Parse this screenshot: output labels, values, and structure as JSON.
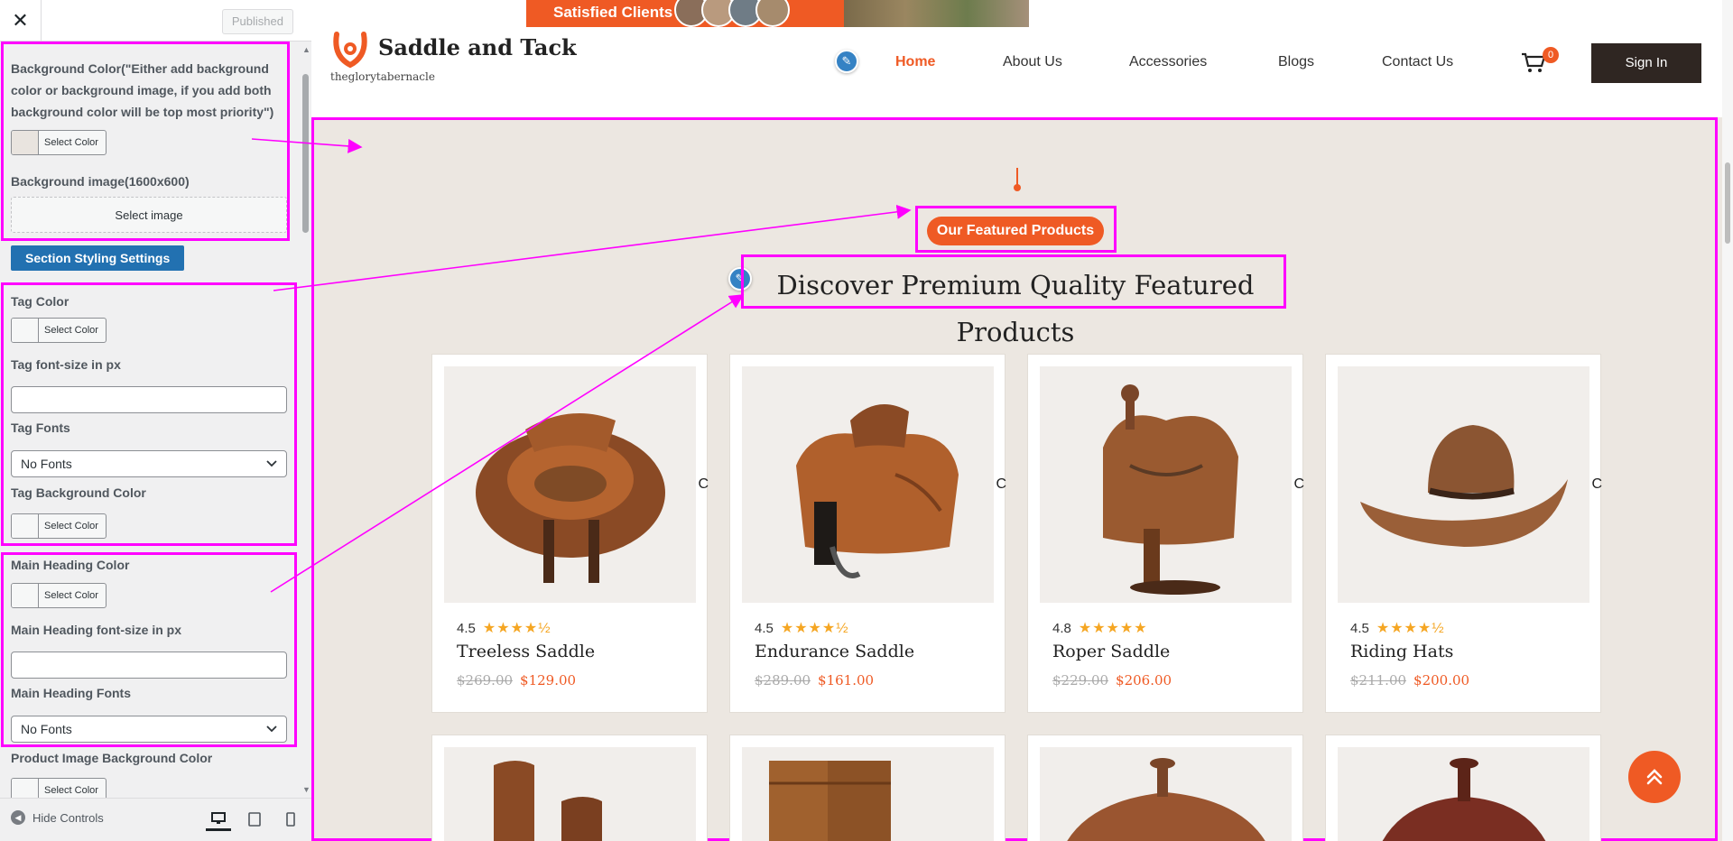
{
  "sidebar": {
    "close_icon": "close-icon",
    "published_label": "Published",
    "bg_color_label": "Background Color(\"Either add background color or background image, if you add both background color will be top most priority\")",
    "select_color_label": "Select Color",
    "bg_image_label": "Background image(1600x600)",
    "select_image_label": "Select image",
    "section_styling_button": "Section Styling Settings",
    "tag_color_label": "Tag Color",
    "tag_font_size_label": "Tag font-size in px",
    "tag_fonts_label": "Tag Fonts",
    "tag_fonts_value": "No Fonts",
    "tag_bg_color_label": "Tag Background Color",
    "main_heading_color_label": "Main Heading Color",
    "main_heading_font_size_label": "Main Heading font-size in px",
    "main_heading_fonts_label": "Main Heading Fonts",
    "main_heading_fonts_value": "No Fonts",
    "product_image_bg_label": "Product Image Background Color",
    "hide_controls_label": "Hide Controls",
    "bg_swatch_color": "#e9e4df",
    "swatch_empty_color": "#f6f7f7"
  },
  "preview": {
    "promo_text": "Satisfied Clients",
    "logo_title": "Saddle and Tack",
    "logo_subtitle": "theglorytabernacle",
    "nav": [
      {
        "label": "Home"
      },
      {
        "label": "About Us"
      },
      {
        "label": "Accessories"
      },
      {
        "label": "Blogs"
      },
      {
        "label": "Contact Us"
      }
    ],
    "cart_count": "0",
    "signin_label": "Sign In",
    "tag_text": "Our Featured Products",
    "main_heading": "Discover Premium Quality Featured Products",
    "products": [
      {
        "rating": "4.5",
        "stars": "★★★★½",
        "title": "Treeless Saddle",
        "old_price": "$269.00",
        "price": "$129.00",
        "clip": "C"
      },
      {
        "rating": "4.5",
        "stars": "★★★★½",
        "title": "Endurance Saddle",
        "old_price": "$289.00",
        "price": "$161.00",
        "clip": "C"
      },
      {
        "rating": "4.8",
        "stars": "★★★★★",
        "title": "Roper Saddle",
        "old_price": "$229.00",
        "price": "$206.00",
        "clip": "C"
      },
      {
        "rating": "4.5",
        "stars": "★★★★½",
        "title": "Riding Hats",
        "old_price": "$211.00",
        "price": "$200.00",
        "clip": "C"
      }
    ],
    "accent_color": "#ef5a24",
    "highlight_color": "#ff00ff"
  }
}
